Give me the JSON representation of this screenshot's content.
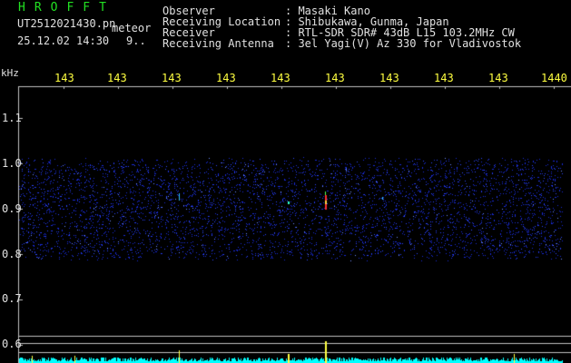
{
  "header": {
    "brand": "HROFFT",
    "filename": "UT2512021430.pn",
    "filename_suffix": "meteor",
    "timestamp": "25.12.02 14:30",
    "timestamp_extra": "9.."
  },
  "info": [
    {
      "key": "Observer",
      "value": ": Masaki Kano"
    },
    {
      "key": "Receiving Location",
      "value": ": Shibukawa, Gunma, Japan"
    },
    {
      "key": "Receiver",
      "value": ": RTL-SDR SDR# 43dB L15 103.2MHz CW"
    },
    {
      "key": "Receiving Antenna",
      "value": ": 3el Yagi(V) Az 330 for Vladivostok"
    }
  ],
  "axis": {
    "y_unit": "kHz",
    "x_ticks": [
      "143",
      "143",
      "143",
      "143",
      "143",
      "143",
      "143",
      "143",
      "143",
      "1440"
    ],
    "y_ticks": [
      "1.1",
      "1.0",
      "0.9",
      "0.8",
      "0.7",
      "0.6"
    ]
  },
  "colors": {
    "background": "#000000",
    "noise": "#1a2bd8",
    "grid": "#c0c0c0",
    "x_labels": "#ffff40",
    "brand": "#22e022",
    "text": "#e0e0e0",
    "level": "#00ffff"
  },
  "signal": {
    "band_low_khz": 0.8,
    "band_high_khz": 1.0,
    "echo_khz": 0.91
  }
}
